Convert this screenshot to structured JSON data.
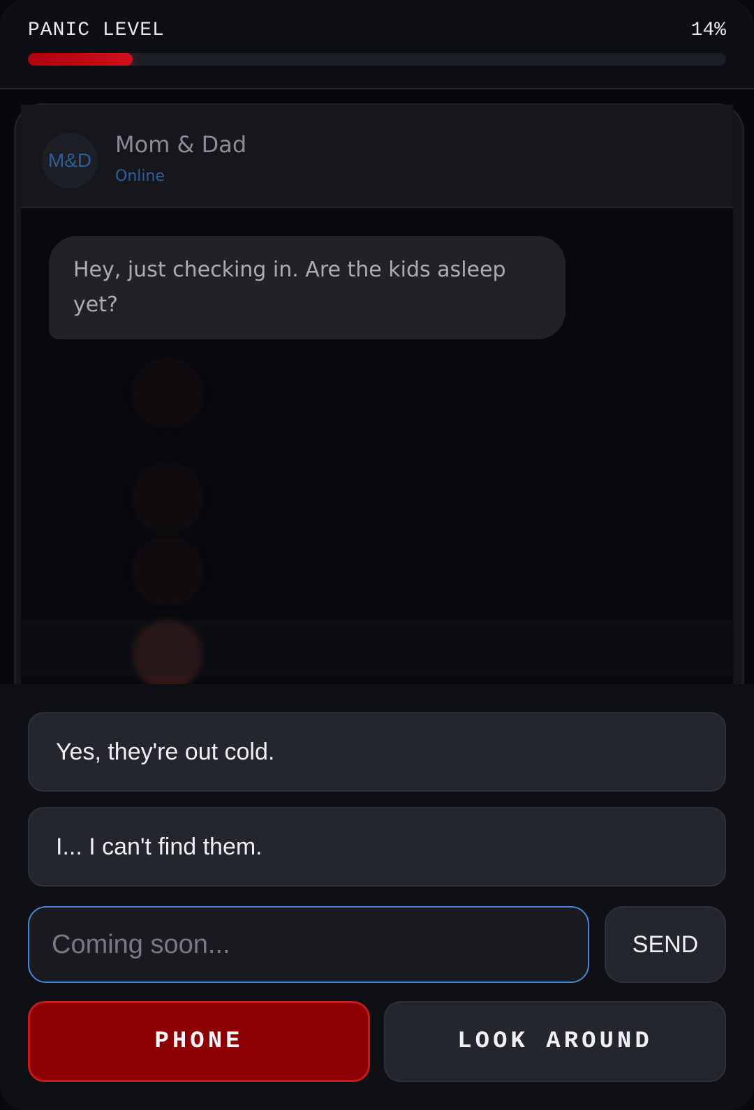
{
  "panic": {
    "label": "PANIC LEVEL",
    "value_text": "14%",
    "value_fraction": 0.15,
    "bar_color": "#c8101a"
  },
  "contact": {
    "avatar_initials": "M&D",
    "name": "Mom & Dad",
    "status": "Online",
    "status_color": "#2e5f9c"
  },
  "messages": [
    {
      "from": "contact",
      "text": "Hey, just checking in. Are the kids asleep yet?"
    }
  ],
  "replies": {
    "option1": "Yes, they're out cold.",
    "option2": "I... I can't find them."
  },
  "composer": {
    "placeholder": "Coming soon...",
    "send_label": "SEND"
  },
  "actions": {
    "phone_label": "PHONE",
    "look_label": "LOOK AROUND"
  },
  "colors": {
    "accent_blue": "#4a86d0",
    "danger_red": "#8c0003"
  }
}
